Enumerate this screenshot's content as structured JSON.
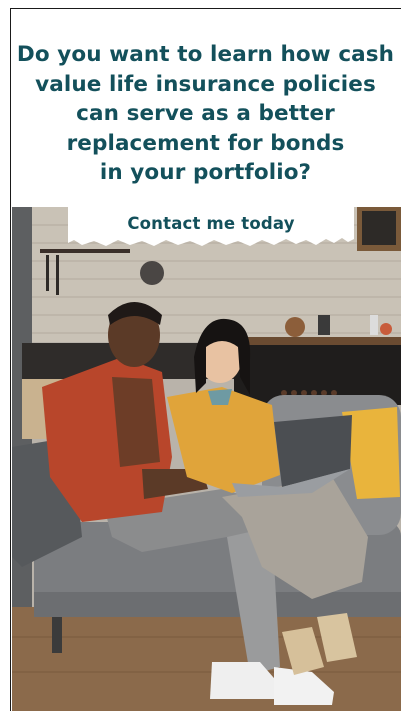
{
  "ad": {
    "headline_lines": [
      "Do you want to learn how cash",
      "value life insurance policies",
      "can serve as a better",
      "replacement for bonds",
      "in your portfolio?"
    ],
    "cta_label": "Contact me today"
  },
  "colors": {
    "headline": "#13505b",
    "background": "#ffffff"
  },
  "photo": {
    "description_icon": "photo-couple-on-sofa"
  }
}
